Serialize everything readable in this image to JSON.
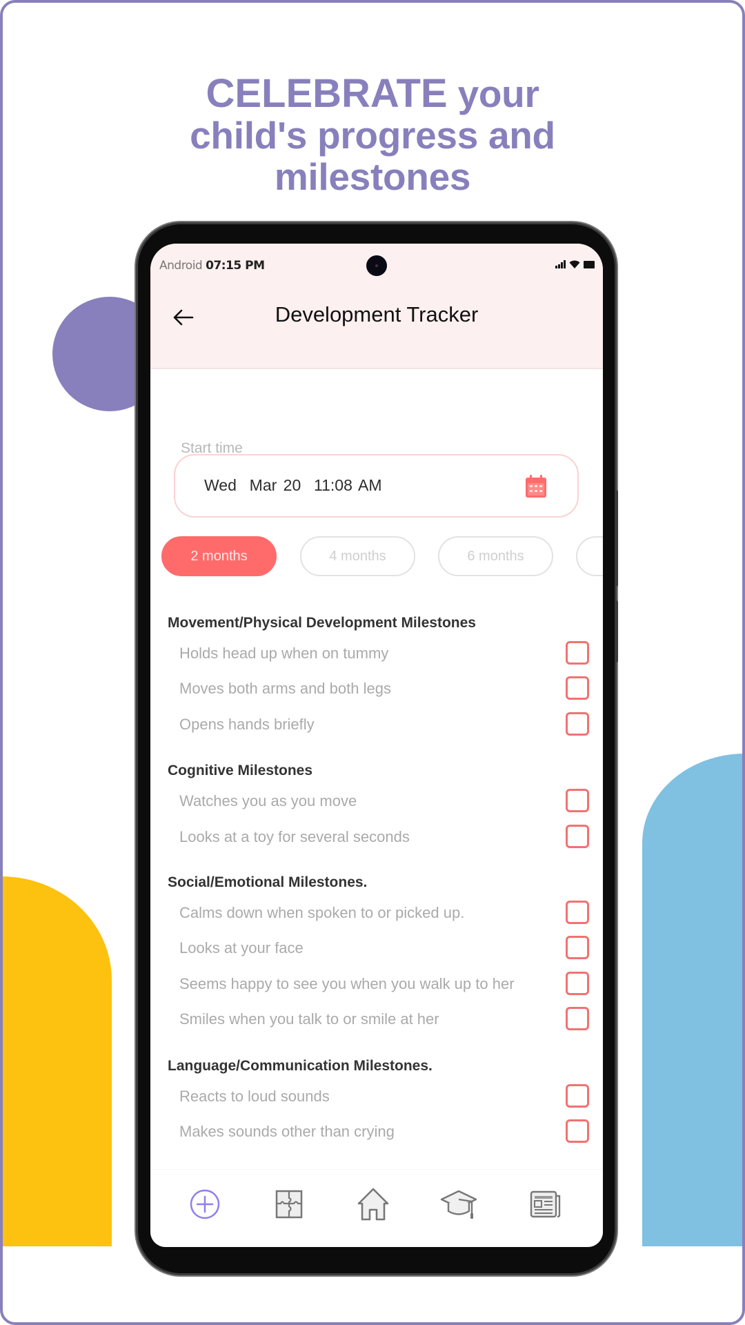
{
  "headline": {
    "strong": "CELEBRATE",
    "line1_rest": " your",
    "line2": "child's progress and",
    "line3": "milestones"
  },
  "colors": {
    "brand_purple": "#8880BC",
    "accent_coral": "#FF6B6B",
    "deco_yellow": "#FDC10F",
    "deco_blue": "#80C0E0",
    "header_bg": "#FDF0F0"
  },
  "status_bar": {
    "carrier": "Android",
    "time": "07:15 PM",
    "icons": [
      "signal-icon",
      "wifi-icon",
      "battery-icon"
    ]
  },
  "app_bar": {
    "back_icon": "arrow-left-icon",
    "title": "Development Tracker"
  },
  "start_time": {
    "label": "Start time",
    "value": "Wed  Mar 20  11:08 AM",
    "icon": "calendar-icon"
  },
  "age_tabs": [
    {
      "label": "2 months",
      "active": true
    },
    {
      "label": "4 months",
      "active": false
    },
    {
      "label": "6 months",
      "active": false
    },
    {
      "label": "",
      "active": false
    }
  ],
  "sections": [
    {
      "title": "Movement/Physical Development Milestones",
      "items": [
        {
          "label": "Holds head up when on tummy",
          "checked": false
        },
        {
          "label": "Moves both arms and both legs",
          "checked": false
        },
        {
          "label": "Opens hands briefly",
          "checked": false
        }
      ]
    },
    {
      "title": "Cognitive Milestones",
      "items": [
        {
          "label": "Watches you as you move",
          "checked": false
        },
        {
          "label": "Looks at a toy for several seconds",
          "checked": false
        }
      ]
    },
    {
      "title": "Social/Emotional Milestones.",
      "items": [
        {
          "label": "Calms down when spoken to or picked up.",
          "checked": false
        },
        {
          "label": "Looks at your face",
          "checked": false
        },
        {
          "label": "Seems happy to see you when you walk up to her",
          "checked": false
        },
        {
          "label": "Smiles when you talk to or smile at her",
          "checked": false
        }
      ]
    },
    {
      "title": "Language/Communication Milestones.",
      "items": [
        {
          "label": "Reacts to loud sounds",
          "checked": false
        },
        {
          "label": "Makes sounds other than crying",
          "checked": false
        }
      ]
    }
  ],
  "bottom_nav": [
    {
      "icon": "plus-circle-icon",
      "active": true
    },
    {
      "icon": "puzzle-icon",
      "active": false
    },
    {
      "icon": "home-icon",
      "active": false
    },
    {
      "icon": "graduation-cap-icon",
      "active": false
    },
    {
      "icon": "newspaper-icon",
      "active": false
    }
  ]
}
